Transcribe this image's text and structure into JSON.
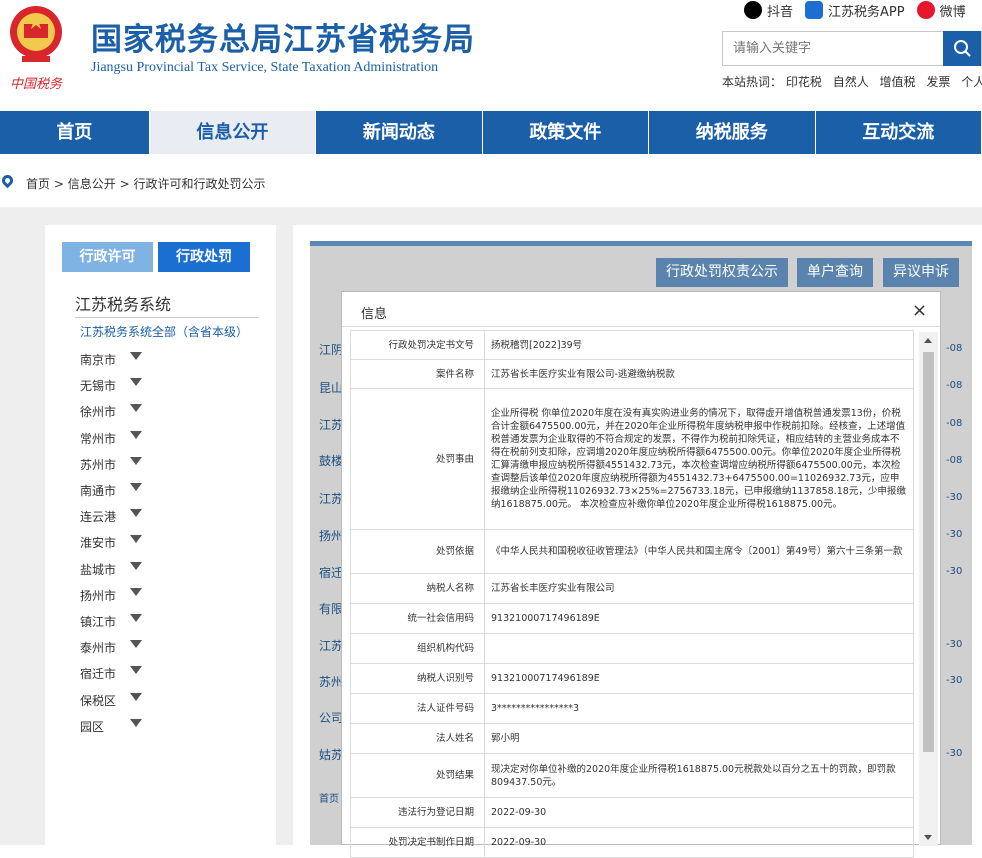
{
  "header": {
    "title_cn": "国家税务总局江苏省税务局",
    "title_en": "Jiangsu Provincial Tax Service, State Taxation Administration",
    "logo_text": "中国税务",
    "top_links": [
      {
        "label": "抖音",
        "icon": "douyin-icon",
        "color": "#000000"
      },
      {
        "label": "江苏税务APP",
        "icon": "app-icon",
        "color": "#1a6fd0"
      },
      {
        "label": "微博",
        "icon": "weibo-icon",
        "color": "#e6162d"
      }
    ],
    "search_placeholder": "请输入关键字",
    "hot_label": "本站热词：",
    "hot_words": [
      "印花税",
      "自然人",
      "增值税",
      "发票",
      "个人"
    ]
  },
  "nav": {
    "items": [
      "首页",
      "信息公开",
      "新闻动态",
      "政策文件",
      "纳税服务",
      "互动交流"
    ],
    "active": "信息公开"
  },
  "breadcrumb": [
    "首页",
    "信息公开",
    "行政许可和行政处罚公示"
  ],
  "sidebar": {
    "tab_permit": "行政许可",
    "tab_penalty": "行政处罚",
    "system": "江苏税务系统",
    "all": "江苏税务系统全部（含省本级）",
    "cities": [
      "南京市",
      "无锡市",
      "徐州市",
      "常州市",
      "苏州市",
      "南通市",
      "连云港",
      "淮安市",
      "盐城市",
      "扬州市",
      "镇江市",
      "泰州市",
      "宿迁市",
      "保税区",
      "园区"
    ]
  },
  "main": {
    "buttons": [
      "行政处罚权责公示",
      "单户查询",
      "异议申诉"
    ],
    "row_labels": [
      "江阴",
      "昆山",
      "江苏",
      "鼓楼",
      "江苏",
      "扬州",
      "宿迁",
      "有限",
      "江苏",
      "苏州",
      "公司",
      "姑苏",
      "首页"
    ],
    "row_dates": [
      "-08",
      "-08",
      "-08",
      "-08",
      "-30",
      "-30",
      "-30",
      "-30",
      "-30",
      "-30"
    ]
  },
  "modal": {
    "title": "信息",
    "close": "×",
    "rows": [
      {
        "key": "行政处罚决定书文号",
        "value": "扬税稽罚[2022]39号"
      },
      {
        "key": "案件名称",
        "value": "江苏省长丰医疗实业有限公司-逃避缴纳税款"
      },
      {
        "key": "处罚事由",
        "value": "企业所得税 你单位2020年度在没有真实购进业务的情况下，取得虚开增值税普通发票13份，价税合计金额6475500.00元，并在2020年企业所得税年度纳税申报中作税前扣除。经核查，上述增值税普通发票为企业取得的不符合规定的发票，不得作为税前扣除凭证，相应结转的主营业务成本不得在税前列支扣除，应调增2020年度应纳税所得额6475500.00元。你单位2020年度企业所得税汇算清缴申报应纳税所得额4551432.73元，本次检查调增应纳税所得额6475500.00元，本次检查调整后该单位2020年度应纳税所得额为4551432.73+6475500.00=11026932.73元，应申报缴纳企业所得税11026932.73×25%=2756733.18元，已申报缴纳1137858.18元，少申报缴纳1618875.00元。 本次检查应补缴你单位2020年度企业所得税1618875.00元。"
      },
      {
        "key": "处罚依据",
        "value": "《中华人民共和国税收征收管理法》（中华人民共和国主席令〔2001〕第49号）第六十三条第一款"
      },
      {
        "key": "纳税人名称",
        "value": "江苏省长丰医疗实业有限公司"
      },
      {
        "key": "统一社会信用码",
        "value": "91321000717496189E"
      },
      {
        "key": "组织机构代码",
        "value": ""
      },
      {
        "key": "纳税人识别号",
        "value": "91321000717496189E"
      },
      {
        "key": "法人证件号码",
        "value": "3****************3"
      },
      {
        "key": "法人姓名",
        "value": "郭小明"
      },
      {
        "key": "处罚结果",
        "value": "现决定对你单位补缴的2020年度企业所得税1618875.00元税款处以百分之五十的罚款，即罚款809437.50元。"
      },
      {
        "key": "违法行为登记日期",
        "value": "2022-09-30"
      },
      {
        "key": "处罚决定书制作日期",
        "value": "2022-09-30"
      }
    ]
  }
}
